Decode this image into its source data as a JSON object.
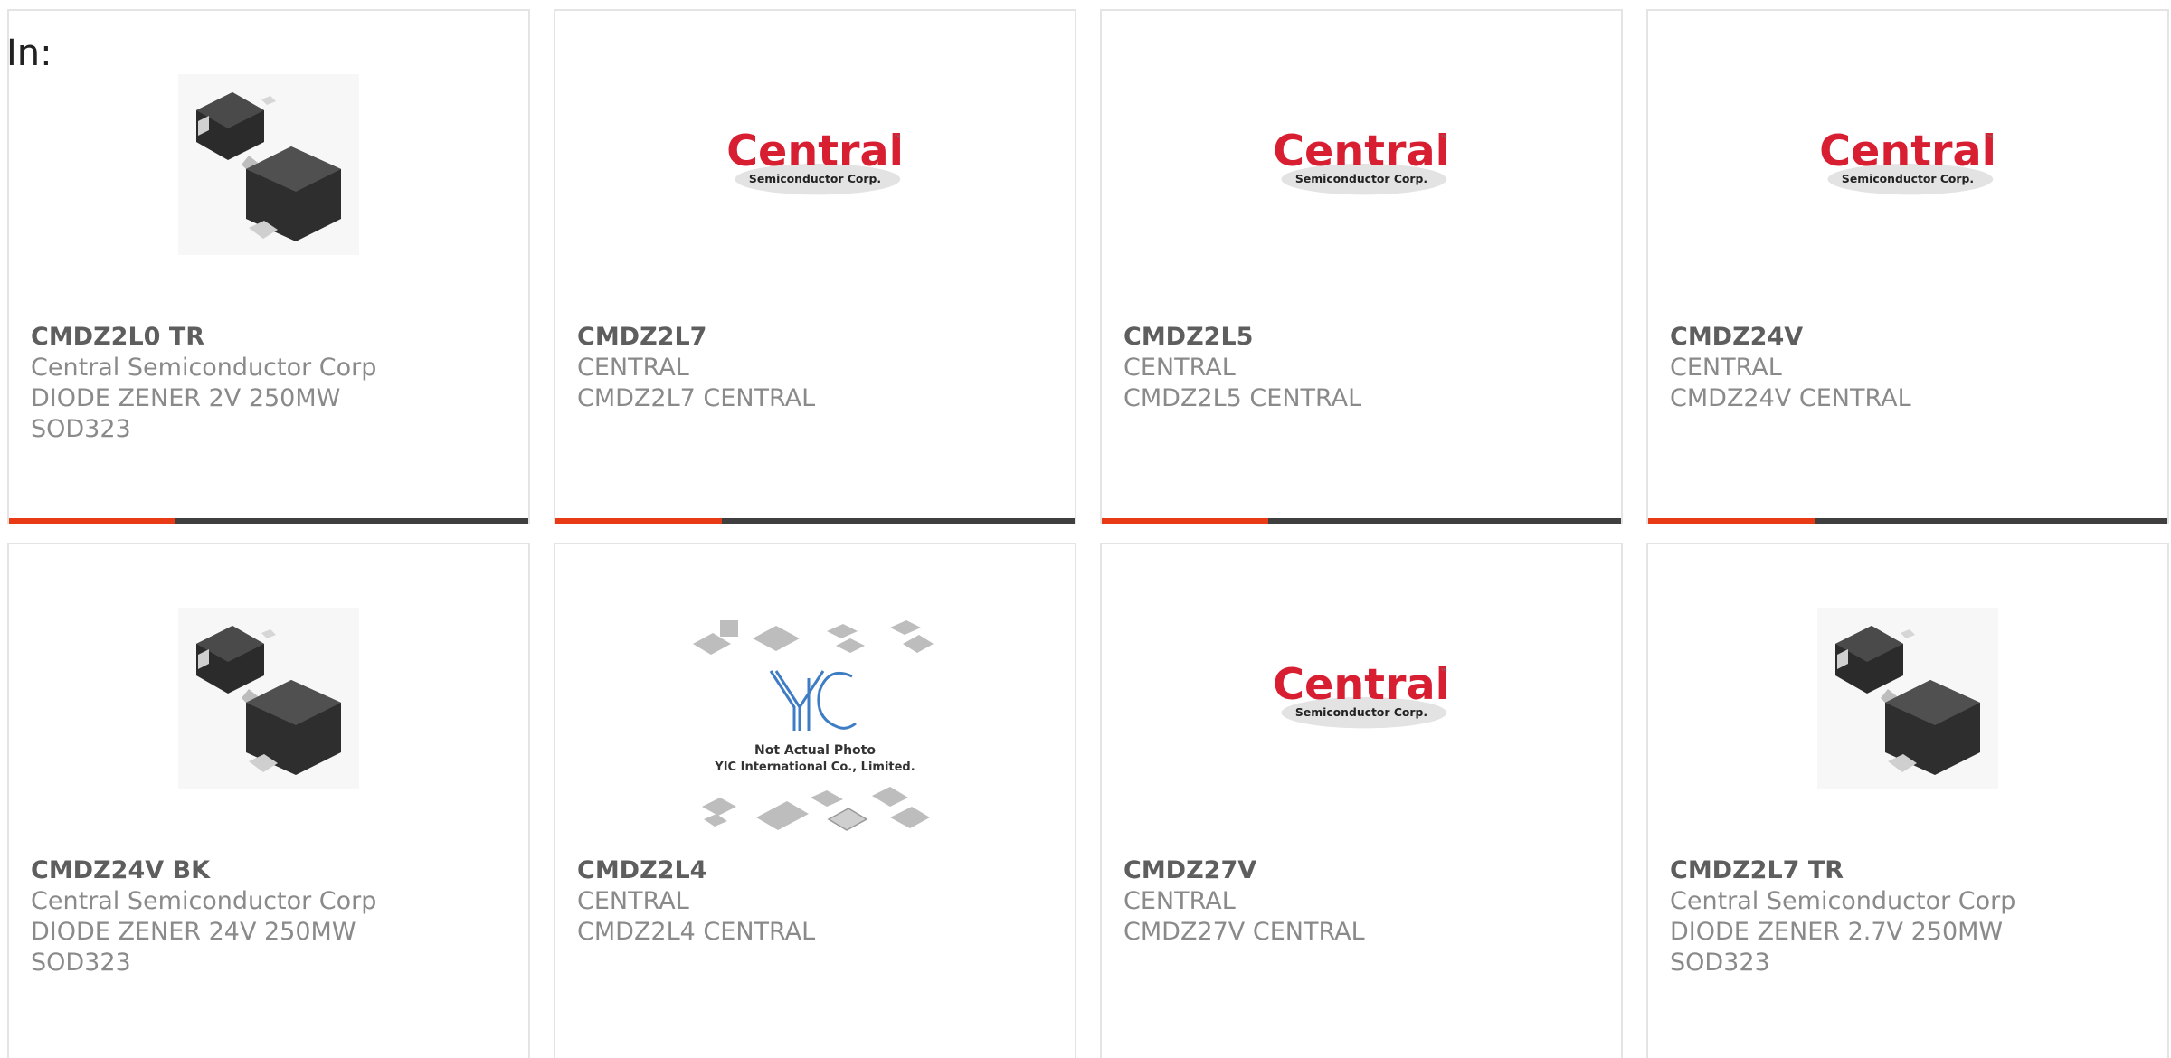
{
  "header": {
    "filter_label": "In:"
  },
  "colors": {
    "progress": "#e83a14",
    "progress_track": "#3f3f3f",
    "logo_red": "#d81f32"
  },
  "products": [
    {
      "part_number": "CMDZ2L0 TR",
      "manufacturer": "Central Semiconductor Corp",
      "description": [
        "DIODE ZENER 2V 250MW",
        "SOD323"
      ],
      "image": "sod323-package-icon",
      "progress": 0.32
    },
    {
      "part_number": "CMDZ2L7",
      "manufacturer": "CENTRAL",
      "description": [
        "CMDZ2L7 CENTRAL"
      ],
      "image": "central-logo",
      "progress": 0.32
    },
    {
      "part_number": "CMDZ2L5",
      "manufacturer": "CENTRAL",
      "description": [
        "CMDZ2L5 CENTRAL"
      ],
      "image": "central-logo",
      "progress": 0.32
    },
    {
      "part_number": "CMDZ24V",
      "manufacturer": "CENTRAL",
      "description": [
        "CMDZ24V CENTRAL"
      ],
      "image": "central-logo",
      "progress": 0.32
    },
    {
      "part_number": "CMDZ24V BK",
      "manufacturer": "Central Semiconductor Corp",
      "description": [
        "DIODE ZENER 24V 250MW",
        "SOD323"
      ],
      "image": "sod323-package-icon",
      "progress": null
    },
    {
      "part_number": "CMDZ2L4",
      "manufacturer": "CENTRAL",
      "description": [
        "CMDZ2L4 CENTRAL"
      ],
      "image": "yic-placeholder",
      "progress": null
    },
    {
      "part_number": "CMDZ27V",
      "manufacturer": "CENTRAL",
      "description": [
        "CMDZ27V CENTRAL"
      ],
      "image": "central-logo",
      "progress": null
    },
    {
      "part_number": "CMDZ2L7 TR",
      "manufacturer": "Central Semiconductor Corp",
      "description": [
        "DIODE ZENER 2.7V 250MW",
        "SOD323"
      ],
      "image": "sod323-package-icon",
      "progress": null
    }
  ],
  "logo_text": {
    "brand": "Central",
    "tm": "™",
    "sub": "Semiconductor Corp."
  },
  "placeholder_text": {
    "caption": "Not Actual Photo",
    "company": "YIC International Co., Limited.",
    "mark": "YIC"
  }
}
